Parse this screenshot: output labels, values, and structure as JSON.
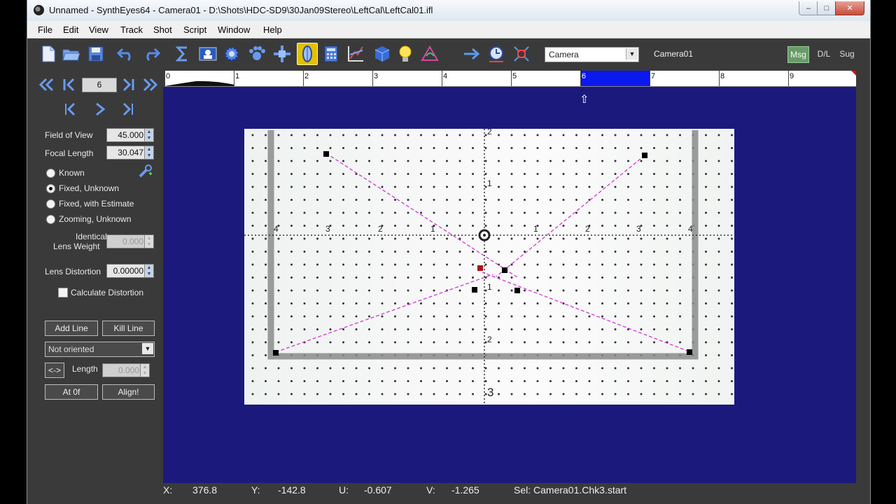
{
  "window": {
    "title": "Unnamed - SynthEyes64 - Camera01 - D:\\Shots\\HDC-SD9\\30Jan09Stereo\\LeftCal\\LeftCal01.ifl",
    "controls": {
      "minimize": "–",
      "maximize": "□",
      "close": "✕"
    }
  },
  "menu": [
    "File",
    "Edit",
    "View",
    "Track",
    "Shot",
    "Script",
    "Window",
    "Help"
  ],
  "toolbar": {
    "camera_select": "Camera",
    "camera_name": "Camera01",
    "msg": "Msg",
    "dl": "D/L",
    "sug": "Sug",
    "accent": "#e3c000"
  },
  "panel": {
    "frame": "6",
    "field_of_view_label": "Field of View",
    "field_of_view_value": "45.000",
    "focal_length_label": "Focal Length",
    "focal_length_value": "30.047",
    "radio_known": "Known",
    "radio_fixed_unknown": "Fixed, Unknown",
    "radio_fixed_estimate": "Fixed, with Estimate",
    "radio_zooming": "Zooming, Unknown",
    "selected_radio": "Fixed, Unknown",
    "identical_label_1": "Identical",
    "identical_label_2": "Lens Weight",
    "identical_value": "0.000",
    "lens_distortion_label": "Lens Distortion",
    "lens_distortion_value": "0.00000",
    "calc_distortion_label": "Calculate Distortion",
    "add_line": "Add Line",
    "kill_line": "Kill Line",
    "orientation": "Not oriented",
    "swap": "<->",
    "length_label": "Length",
    "length_value": "0.000",
    "at0": "At 0f",
    "align": "Align!"
  },
  "timeline": {
    "labels": [
      "0",
      "1",
      "2",
      "3",
      "4",
      "5",
      "6",
      "7",
      "8",
      "9"
    ],
    "selected_frame": 6,
    "selection_color": "#0b18ee"
  },
  "grid_labels": {
    "h_left": [
      "4",
      "3",
      "2",
      "1"
    ],
    "h_right": [
      "1",
      "2",
      "3",
      "4"
    ],
    "v_top": [
      "2",
      "1"
    ],
    "v_bottom": [
      "1",
      "2",
      "3"
    ]
  },
  "status": {
    "x_label": "X:",
    "x_value": "376.8",
    "y_label": "Y:",
    "y_value": "-142.8",
    "u_label": "U:",
    "u_value": "-0.607",
    "v_label": "V:",
    "v_value": "-1.265",
    "sel": "Sel: Camera01.Chk3.start"
  }
}
